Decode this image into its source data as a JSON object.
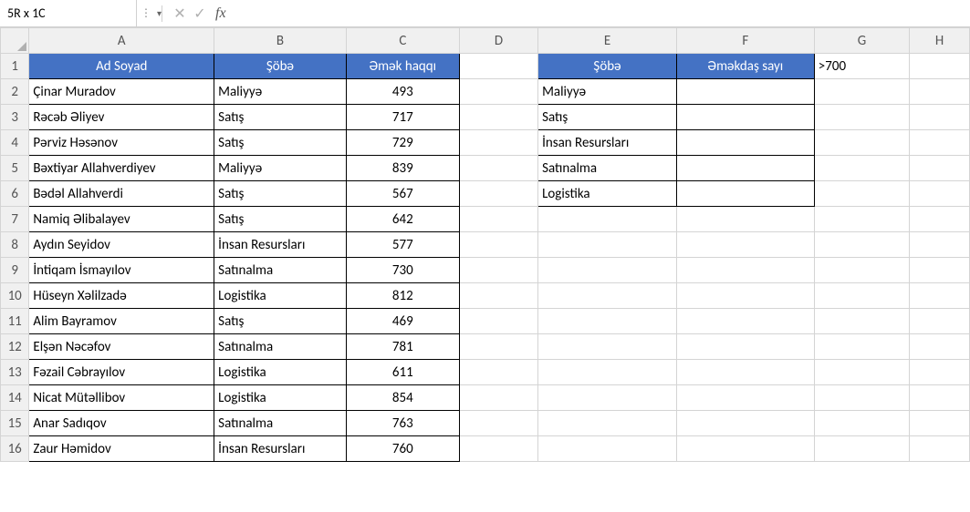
{
  "namebox": "5R x 1C",
  "formula": "",
  "columns": [
    "A",
    "B",
    "C",
    "D",
    "E",
    "F",
    "G",
    "H"
  ],
  "rows": [
    "1",
    "2",
    "3",
    "4",
    "5",
    "6",
    "7",
    "8",
    "9",
    "10",
    "11",
    "12",
    "13",
    "14",
    "15",
    "16"
  ],
  "t1": {
    "h": [
      "Ad Soyad",
      "Şöbə",
      "Əmək haqqı"
    ],
    "rows": [
      [
        "Çinar Muradov",
        "Maliyyə",
        "493"
      ],
      [
        "Rəcəb Əliyev",
        "Satış",
        "717"
      ],
      [
        "Pərviz Həsənov",
        "Satış",
        "729"
      ],
      [
        "Bəxtiyar Allahverdiyev",
        "Maliyyə",
        "839"
      ],
      [
        "Bədəl Allahverdi",
        "Satış",
        "567"
      ],
      [
        "Namiq Əlibalayev",
        "Satış",
        "642"
      ],
      [
        "Aydın Seyidov",
        "İnsan Resursları",
        "577"
      ],
      [
        "İntiqam İsmayılov",
        "Satınalma",
        "730"
      ],
      [
        "Hüseyn Xəlilzadə",
        "Logistika",
        "812"
      ],
      [
        "Alim Bayramov",
        "Satış",
        "469"
      ],
      [
        "Elşən Nəcəfov",
        "Satınalma",
        "781"
      ],
      [
        "Fəzail Cəbrayılov",
        "Logistika",
        "611"
      ],
      [
        "Nicat Mütəllibov",
        "Logistika",
        "854"
      ],
      [
        "Anar Sadıqov",
        "Satınalma",
        "763"
      ],
      [
        "Zaur Həmidov",
        "İnsan Resursları",
        "760"
      ]
    ]
  },
  "t2": {
    "h": [
      "Şöbə",
      "Əməkdaş sayı"
    ],
    "rows": [
      [
        "Maliyyə",
        ""
      ],
      [
        "Satış",
        ""
      ],
      [
        "İnsan Resursları",
        ""
      ],
      [
        "Satınalma",
        ""
      ],
      [
        "Logistika",
        ""
      ]
    ]
  },
  "g1": ">700"
}
